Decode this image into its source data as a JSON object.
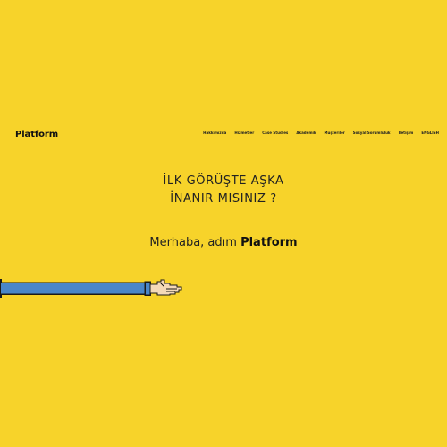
{
  "header": {
    "logo": "Platform",
    "nav": [
      "Hakkımızda",
      "Hizmetler",
      "Case Studies",
      "Akademik",
      "Müşteriler",
      "Sosyal Sorumluluk",
      "İletişim",
      "ENGLISH"
    ]
  },
  "hero": {
    "headline_line1": "İLK GÖRÜŞTE AŞKA",
    "headline_line2": "İNANIR MISINIZ ?",
    "greeting_prefix": "Merhaba, adım ",
    "greeting_brand": "Platform"
  },
  "illustration": {
    "name": "pixel-arm-handshake",
    "colors": {
      "background": "#f7d32a",
      "sleeve": "#4a86c8",
      "outline": "#1a1a1a",
      "skin": "#f4d9b8"
    }
  }
}
